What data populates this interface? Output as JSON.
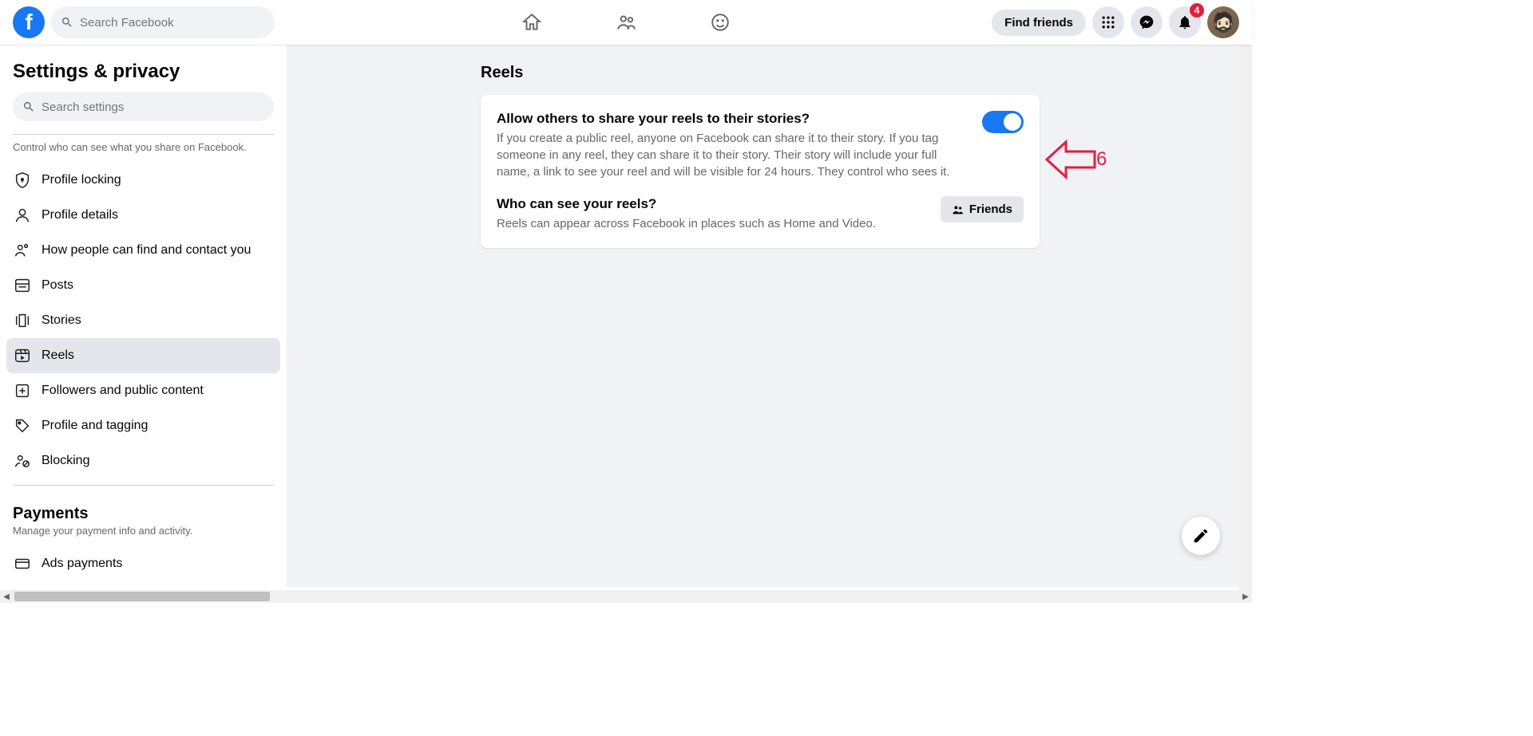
{
  "header": {
    "search_placeholder": "Search Facebook",
    "find_friends": "Find friends",
    "notification_badge": "4"
  },
  "sidebar": {
    "title": "Settings & privacy",
    "search_placeholder": "Search settings",
    "privacy_desc": "Control who can see what you share on Facebook.",
    "items": {
      "profile_locking": "Profile locking",
      "profile_details": "Profile details",
      "how_find": "How people can find and contact you",
      "posts": "Posts",
      "stories": "Stories",
      "reels": "Reels",
      "followers": "Followers and public content",
      "profile_tagging": "Profile and tagging",
      "blocking": "Blocking"
    },
    "payments_title": "Payments",
    "payments_desc": "Manage your payment info and activity.",
    "ads_payments": "Ads payments"
  },
  "main": {
    "heading": "Reels",
    "setting1": {
      "title": "Allow others to share your reels to their stories?",
      "desc": "If you create a public reel, anyone on Facebook can share it to their story. If you tag someone in any reel, they can share it to their story. Their story will include your full name, a link to see your reel and will be visible for 24 hours. They control who sees it."
    },
    "setting2": {
      "title": "Who can see your reels?",
      "desc": "Reels can appear across Facebook in places such as Home and Video.",
      "button": "Friends"
    }
  },
  "annotation": {
    "label": "6"
  }
}
